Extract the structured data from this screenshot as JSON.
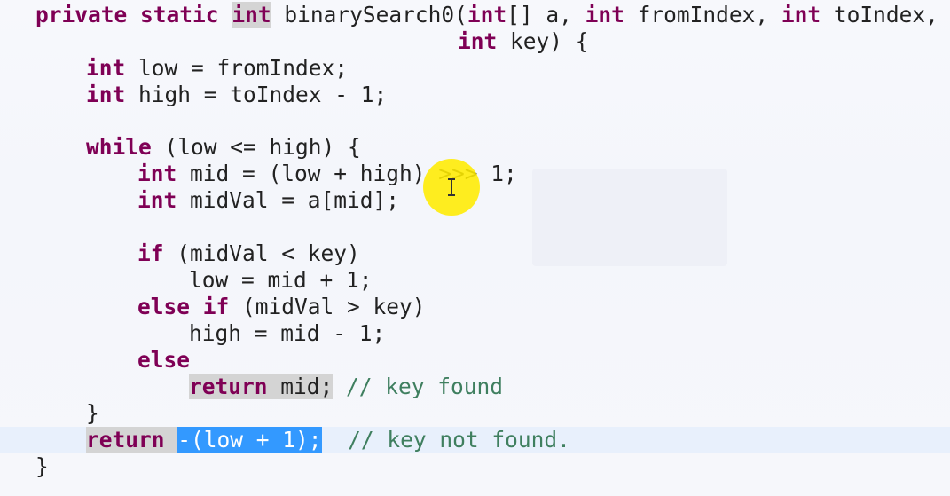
{
  "editor": {
    "colors": {
      "keyword": "#7f0055",
      "comment": "#3f7f5f",
      "selection": "#3399ff",
      "occurrence": "#d4d4d4",
      "current_line": "#e8f0fc",
      "cursor_halo": "#ffec00"
    },
    "lines": [
      {
        "segments": [
          {
            "text": "private",
            "k": "kw"
          },
          {
            "text": " "
          },
          {
            "text": "static",
            "k": "kw"
          },
          {
            "text": " "
          },
          {
            "text": "int",
            "k": "kw occ"
          },
          {
            "text": " binarySearch0("
          },
          {
            "text": "int",
            "k": "kw"
          },
          {
            "text": "[] a, "
          },
          {
            "text": "int",
            "k": "kw"
          },
          {
            "text": " fromIndex, "
          },
          {
            "text": "int",
            "k": "kw"
          },
          {
            "text": " toIndex,"
          }
        ]
      },
      {
        "segments": [
          {
            "text": "int",
            "k": "kw"
          },
          {
            "text": " key) {"
          }
        ]
      },
      {
        "segments": [
          {
            "text": "int",
            "k": "kw"
          },
          {
            "text": " low = fromIndex;"
          }
        ]
      },
      {
        "segments": [
          {
            "text": "int",
            "k": "kw"
          },
          {
            "text": " high = toIndex - 1;"
          }
        ]
      },
      {
        "segments": [
          {
            "text": "while",
            "k": "kw"
          },
          {
            "text": " (low <= high) {"
          }
        ]
      },
      {
        "segments": [
          {
            "text": "int",
            "k": "kw"
          },
          {
            "text": " mid = (low + high) >>> 1;"
          }
        ]
      },
      {
        "segments": [
          {
            "text": "int",
            "k": "kw"
          },
          {
            "text": " midVal = a[mid];"
          }
        ]
      },
      {
        "segments": [
          {
            "text": "if",
            "k": "kw"
          },
          {
            "text": " (midVal < key)"
          }
        ]
      },
      {
        "segments": [
          {
            "text": "low = mid + 1;"
          }
        ]
      },
      {
        "segments": [
          {
            "text": "else",
            "k": "kw"
          },
          {
            "text": " "
          },
          {
            "text": "if",
            "k": "kw"
          },
          {
            "text": " (midVal > key)"
          }
        ]
      },
      {
        "segments": [
          {
            "text": "high = mid - 1;"
          }
        ]
      },
      {
        "segments": [
          {
            "text": "else",
            "k": "kw"
          }
        ]
      },
      {
        "segments": [
          {
            "text": "return",
            "k": "kw occ"
          },
          {
            "text": " mid;",
            "k": "occ"
          },
          {
            "text": " "
          },
          {
            "text": "// key found",
            "k": "cm"
          }
        ]
      },
      {
        "segments": [
          {
            "text": "}"
          }
        ]
      },
      {
        "segments": [
          {
            "text": "return",
            "k": "kw occ"
          },
          {
            "text": " ",
            "k": "occ"
          },
          {
            "text": "-(low + 1);",
            "k": "sel"
          },
          {
            "text": "  "
          },
          {
            "text": "// key not found.",
            "k": "cm"
          }
        ]
      },
      {
        "segments": [
          {
            "text": "}"
          }
        ]
      }
    ]
  }
}
